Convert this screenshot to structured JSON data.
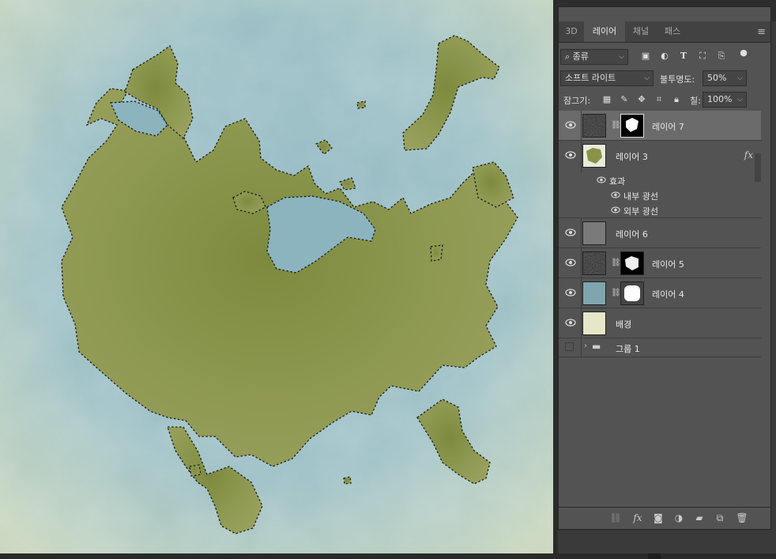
{
  "panel": {
    "tabs": [
      {
        "label": "3D"
      },
      {
        "label": "레이어"
      },
      {
        "label": "채널"
      },
      {
        "label": "패스"
      }
    ],
    "filter_kind": "종류",
    "blend_mode": "소프트 라이트",
    "opacity_label": "불투명도:",
    "opacity_value": "50%",
    "lock_label": "잠그기:",
    "fill_label": "칠:",
    "fill_value": "100%"
  },
  "layers": [
    {
      "name": "레이어 7",
      "selected": true,
      "has_mask": true
    },
    {
      "name": "레이어 3",
      "fx": "fx",
      "effects_label": "효과",
      "effects": [
        "내부 광선",
        "외부 광선"
      ]
    },
    {
      "name": "레이어 6"
    },
    {
      "name": "레이어 5",
      "has_mask": true
    },
    {
      "name": "레이어 4",
      "has_mask": true
    },
    {
      "name": "배경"
    },
    {
      "name": "그룹 1"
    }
  ],
  "colors": {
    "panel_bg": "#535353",
    "selected_row": "#6b6b6b",
    "land": "#8a9248",
    "water": "#8db3bd",
    "layer4_thumb": "#7fa6ae",
    "background_thumb": "#e6e6c8"
  },
  "icons": [
    "search-icon",
    "image-filter-icon",
    "adjustment-filter-icon",
    "type-filter-icon",
    "shape-filter-icon",
    "smart-filter-icon",
    "lock-pixels-icon",
    "lock-brush-icon",
    "lock-move-icon",
    "lock-artboard-icon",
    "lock-all-icon",
    "link-icon",
    "fx-icon",
    "mask-icon",
    "adjustment-icon",
    "folder-icon",
    "new-layer-icon",
    "trash-icon"
  ]
}
